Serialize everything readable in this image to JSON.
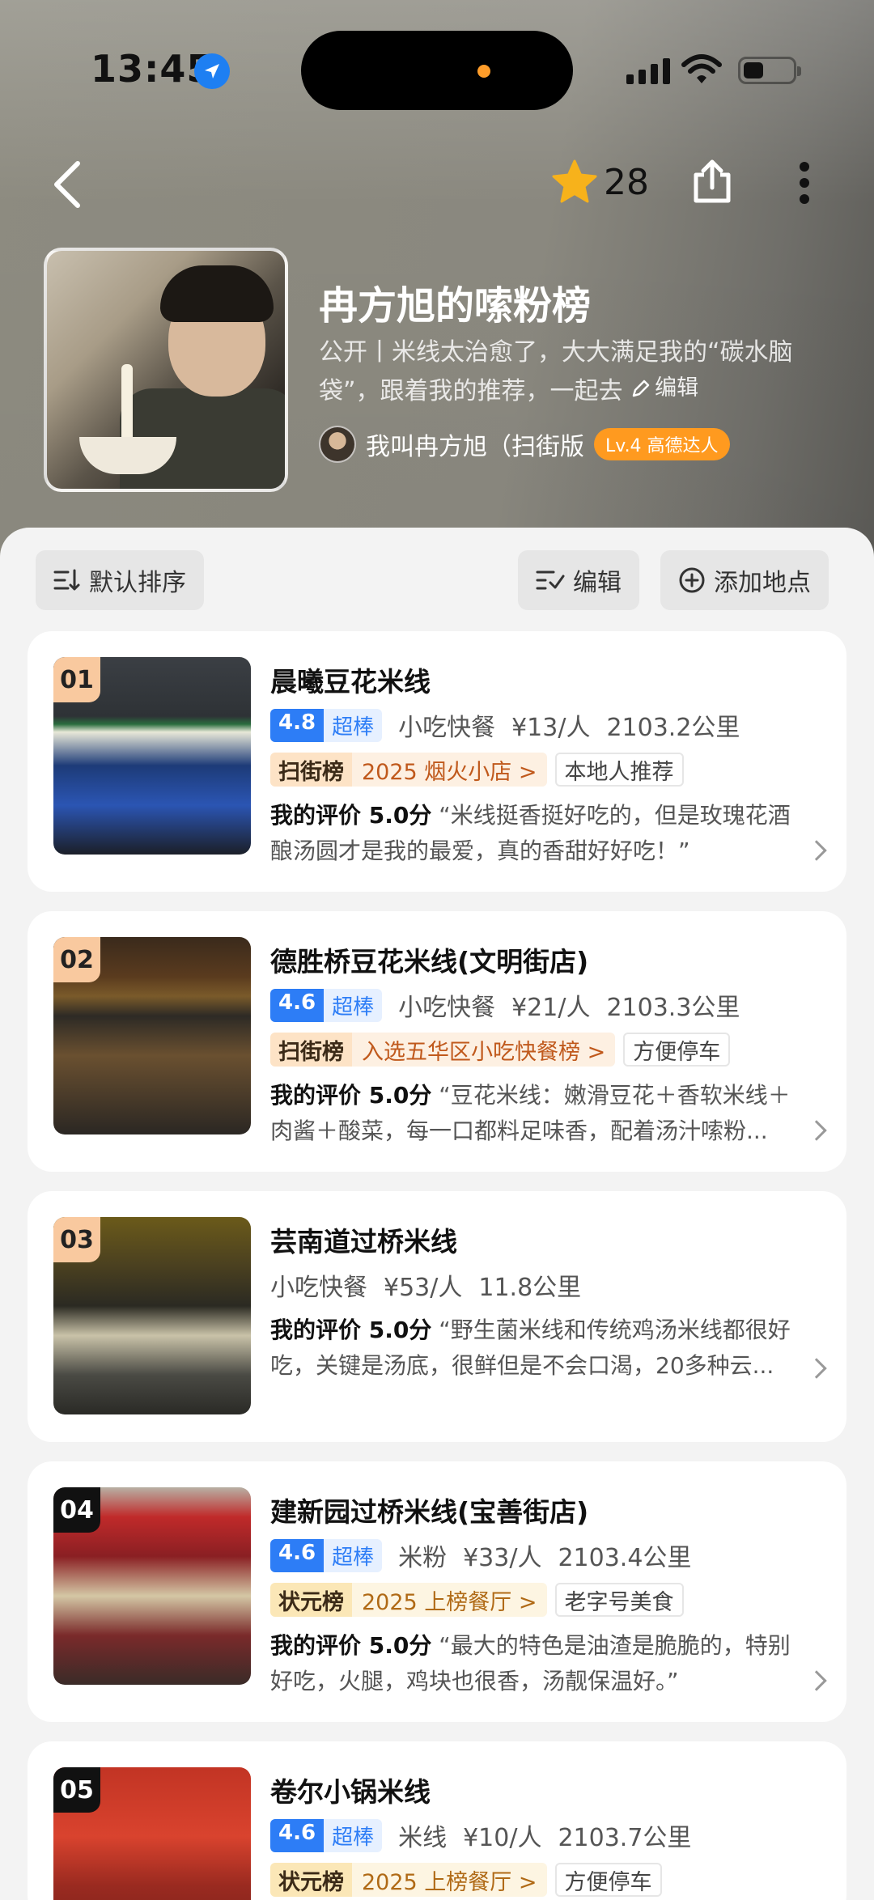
{
  "status_bar": {
    "time": "13:45"
  },
  "nav": {
    "star_count": "28"
  },
  "profile": {
    "title": "冉方旭的嗦粉榜",
    "description": "公开丨米线太治愈了，大大满足我的“碳水脑袋”，跟着我的推荐，一起去",
    "edit_label": "编辑",
    "author_name": "我叫冉方旭（扫街版",
    "level_badge": "Lv.4 高德达人"
  },
  "toolbar": {
    "sort_label": "默认排序",
    "edit_label": "编辑",
    "add_label": "添加地点"
  },
  "places": [
    {
      "rank": "01",
      "name": "晨曦豆花米线",
      "score": "4.8",
      "score_label": "超棒",
      "category": "小吃快餐",
      "price": "¥13/人",
      "distance": "2103.2公里",
      "honor_brand": "扫街榜",
      "honor_text": "2025 烟火小店 >",
      "tag": "本地人推荐",
      "review_label": "我的评价 5.0分",
      "review_text": "“米线挺香挺好吃的，但是玫瑰花酒酿汤圆才是我的最爱，真的香甜好好吃！”"
    },
    {
      "rank": "02",
      "name": "德胜桥豆花米线(文明街店)",
      "score": "4.6",
      "score_label": "超棒",
      "category": "小吃快餐",
      "price": "¥21/人",
      "distance": "2103.3公里",
      "honor_brand": "扫街榜",
      "honor_text": "入选五华区小吃快餐榜 >",
      "tag": "方便停车",
      "review_label": "我的评价 5.0分",
      "review_text": "“豆花米线：嫩滑豆花＋香软米线＋肉酱＋酸菜，每一口都料足味香，配着汤汁嗦粉..."
    },
    {
      "rank": "03",
      "name": "芸南道过桥米线",
      "category": "小吃快餐",
      "price": "¥53/人",
      "distance": "11.8公里",
      "review_label": "我的评价 5.0分",
      "review_text": "“野生菌米线和传统鸡汤米线都很好吃，关键是汤底，很鲜但是不会口渴，20多种云..."
    },
    {
      "rank": "04",
      "name": "建新园过桥米线(宝善街店)",
      "score": "4.6",
      "score_label": "超棒",
      "category": "米粉",
      "price": "¥33/人",
      "distance": "2103.4公里",
      "honor_brand": "状元榜",
      "honor_text": "2025 上榜餐厅 >",
      "tag": "老字号美食",
      "review_label": "我的评价 5.0分",
      "review_text": "“最大的特色是油渣是脆脆的，特别好吃，火腿，鸡块也很香，汤靓保温好。”"
    },
    {
      "rank": "05",
      "name": "卷尔小锅米线",
      "score": "4.6",
      "score_label": "超棒",
      "category": "米线",
      "price": "¥10/人",
      "distance": "2103.7公里",
      "honor_brand": "状元榜",
      "honor_text": "2025 上榜餐厅 >",
      "tag": "方便停车"
    }
  ],
  "colors": {
    "accent_blue": "#2d7df6",
    "level_orange": "#ff9a1f",
    "honor_orange": "#c0591c",
    "star_yellow": "#f7b21b"
  }
}
